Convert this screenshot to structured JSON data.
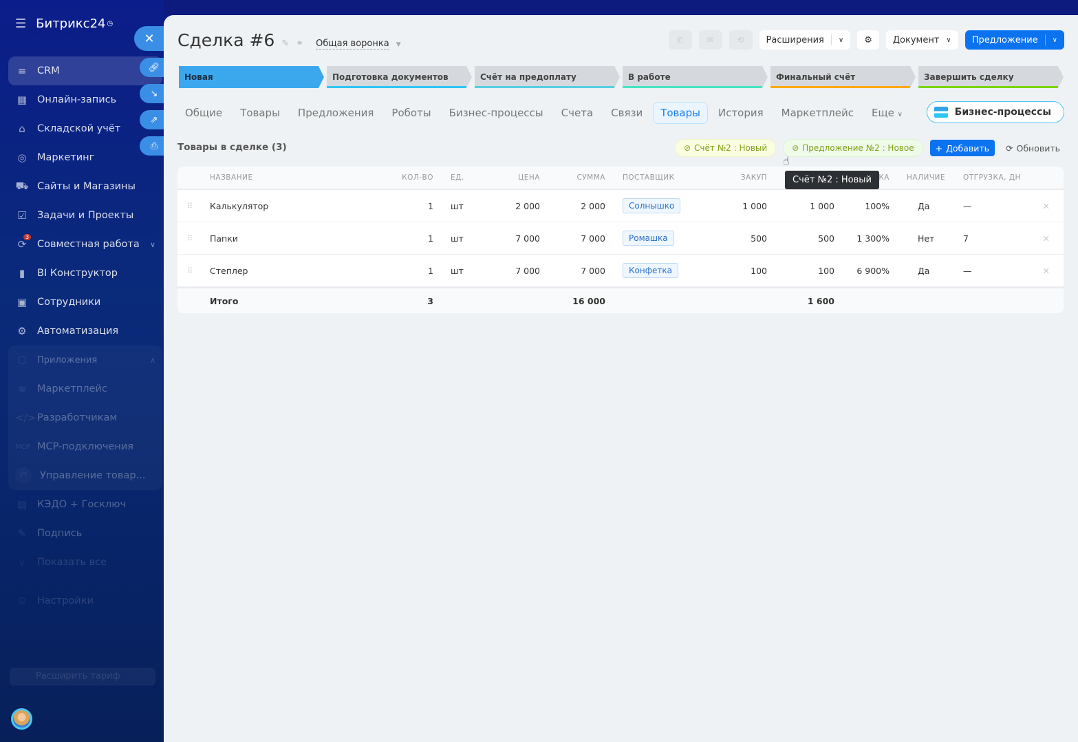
{
  "sidebar": {
    "logo": "Битрикс24",
    "items": [
      {
        "label": "CRM",
        "icon": "filter-icon"
      },
      {
        "label": "Онлайн-запись",
        "icon": "calendar-icon"
      },
      {
        "label": "Складской учёт",
        "icon": "warehouse-icon"
      },
      {
        "label": "Маркетинг",
        "icon": "target-icon"
      },
      {
        "label": "Сайты и Магазины",
        "icon": "cart-icon"
      },
      {
        "label": "Задачи и Проекты",
        "icon": "checkbox-icon"
      },
      {
        "label": "Совместная работа",
        "icon": "collab-icon",
        "badge": "3"
      },
      {
        "label": "BI Конструктор",
        "icon": "chart-icon"
      },
      {
        "label": "Сотрудники",
        "icon": "people-icon"
      },
      {
        "label": "Автоматизация",
        "icon": "robot-icon"
      }
    ],
    "apps_group": {
      "label": "Приложения",
      "items": [
        {
          "label": "Маркетплейс",
          "icon": "marketplace-icon"
        },
        {
          "label": "Разработчикам",
          "icon": "code-icon"
        },
        {
          "label": "MCP-подключения",
          "icon": "mcp-icon",
          "icon_text": "MCP"
        },
        {
          "label": "Управление товар...",
          "icon": "ut-icon",
          "icon_text": "УТ"
        }
      ]
    },
    "more_items": [
      {
        "label": "КЭДО + Госключ",
        "icon": "document-icon"
      },
      {
        "label": "Подпись",
        "icon": "signature-icon"
      },
      {
        "label": "Показать все",
        "icon": "chevron-down-icon"
      }
    ],
    "settings": "Настройки",
    "tariff": "Расширить тариф"
  },
  "header": {
    "title": "Сделка #6",
    "funnel": "Общая воронка"
  },
  "toolbar": {
    "extensions": "Расширения",
    "document": "Документ",
    "offer": "Предложение"
  },
  "stages": [
    {
      "label": "Новая",
      "color": "#3ba8ee"
    },
    {
      "label": "Подготовка документов",
      "color": "#2fc6f6"
    },
    {
      "label": "Счёт на предоплату",
      "color": "#55d0e0"
    },
    {
      "label": "В работе",
      "color": "#47e4c2"
    },
    {
      "label": "Финальный счёт",
      "color": "#ffa900"
    },
    {
      "label": "Завершить сделку",
      "color": "#7bd500"
    }
  ],
  "tabs": [
    "Общие",
    "Товары",
    "Предложения",
    "Роботы",
    "Бизнес-процессы",
    "Счета",
    "Связи",
    "Товары",
    "История",
    "Маркетплейс",
    "Еще"
  ],
  "active_tab_index": 7,
  "bp_button": "Бизнес-процессы",
  "section": {
    "title": "Товары в сделке (3)",
    "chip_invoice": "Счёт №2 : Новый",
    "chip_offer": "Предложение №2 : Новое",
    "add": "Добавить",
    "refresh": "Обновить"
  },
  "table": {
    "headers": {
      "name": "НАЗВАНИЕ",
      "qty": "КОЛ-ВО",
      "unit": "ЕД.",
      "price": "ЦЕНА",
      "sum": "СУММА",
      "supplier": "ПОСТАВЩИК",
      "purchase": "ЗАКУП",
      "markup": "НАЦЕНКА",
      "stock": "НАЛИЧИЕ",
      "shipment": "ОТГРУЗКА, ДН"
    },
    "rows": [
      {
        "name": "Калькулятор",
        "qty": "1",
        "unit": "шт",
        "price": "2 000",
        "sum": "2 000",
        "supplier": "Солнышко",
        "purchase": "1 000",
        "purchase_sum": "1 000",
        "markup": "100%",
        "stock": "Да",
        "shipment": "—"
      },
      {
        "name": "Папки",
        "qty": "1",
        "unit": "шт",
        "price": "7 000",
        "sum": "7 000",
        "supplier": "Ромашка",
        "purchase": "500",
        "purchase_sum": "500",
        "markup": "1 300%",
        "stock": "Нет",
        "shipment": "7"
      },
      {
        "name": "Степлер",
        "qty": "1",
        "unit": "шт",
        "price": "7 000",
        "sum": "7 000",
        "supplier": "Конфетка",
        "purchase": "100",
        "purchase_sum": "100",
        "markup": "6 900%",
        "stock": "Да",
        "shipment": "—"
      }
    ],
    "total": {
      "label": "Итого",
      "qty": "3",
      "sum": "16 000",
      "purchase_sum": "1 600"
    }
  },
  "tooltip": "Счёт №2 : Новый"
}
